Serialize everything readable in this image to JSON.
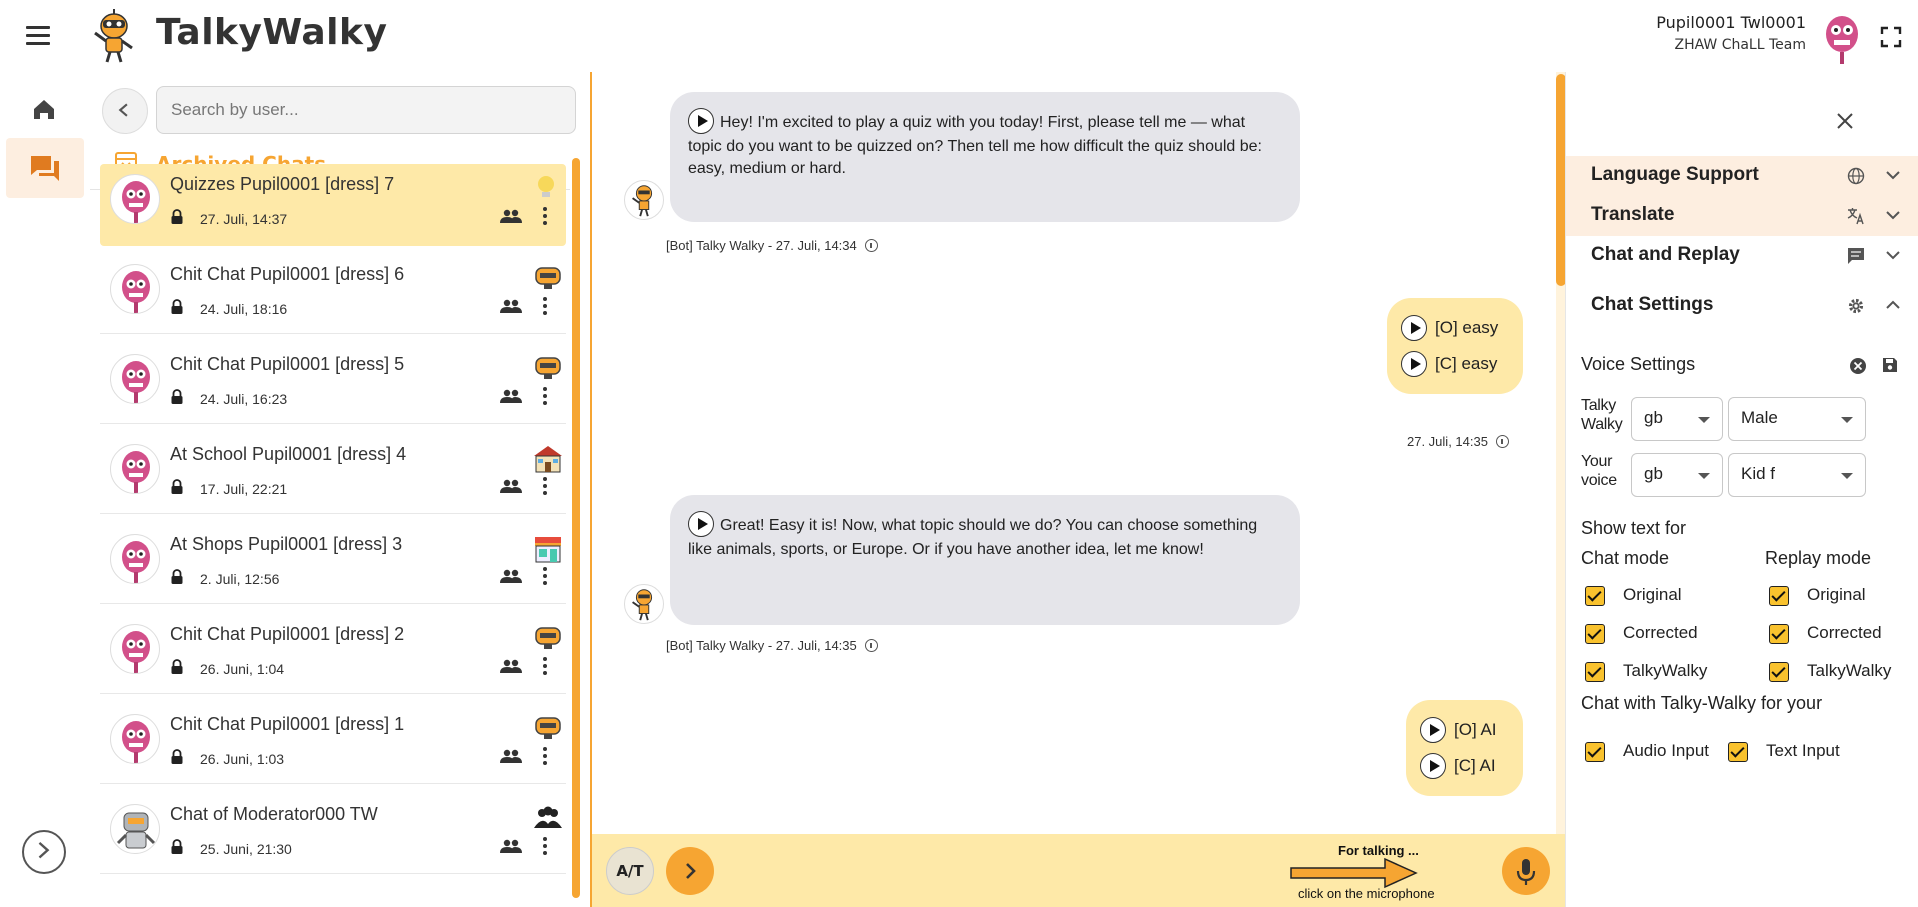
{
  "header": {
    "app_title": "TalkyWalky",
    "user_name": "Pupil0001 Twl0001",
    "user_team": "ZHAW ChaLL Team"
  },
  "sidebar": {
    "items": [
      {
        "name": "home",
        "icon": "home-icon"
      },
      {
        "name": "chats",
        "icon": "chat-icon",
        "active": true
      }
    ]
  },
  "chat_list": {
    "search_placeholder": "Search by user...",
    "archived_label": "Archived Chats",
    "items": [
      {
        "title": "Quizzes Pupil0001 [dress] 7",
        "date": "27. Juli, 14:37",
        "topic_icon": "lightbulb-icon",
        "selected": true
      },
      {
        "title": "Chit Chat Pupil0001 [dress] 6",
        "date": "24. Juli, 18:16",
        "topic_icon": "chit-chat-icon"
      },
      {
        "title": "Chit Chat Pupil0001 [dress] 5",
        "date": "24. Juli, 16:23",
        "topic_icon": "chit-chat-icon"
      },
      {
        "title": "At School Pupil0001 [dress] 4",
        "date": "17. Juli, 22:21",
        "topic_icon": "school-icon"
      },
      {
        "title": "At Shops Pupil0001 [dress] 3",
        "date": "2. Juli, 12:56",
        "topic_icon": "shop-icon"
      },
      {
        "title": "Chit Chat Pupil0001 [dress] 2",
        "date": "26. Juni, 1:04",
        "topic_icon": "chit-chat-icon"
      },
      {
        "title": "Chit Chat Pupil0001 [dress] 1",
        "date": "26. Juni, 1:03",
        "topic_icon": "chit-chat-icon"
      },
      {
        "title": "Chat of Moderator000 TW",
        "date": "25. Juni, 21:30",
        "topic_icon": "group-icon"
      }
    ]
  },
  "conversation": {
    "messages": [
      {
        "role": "bot",
        "text": "Hey! I'm excited to play a quiz with you today! First, please tell me — what topic do you want to be quizzed on? Then tell me how difficult the quiz should be: easy, medium or hard.",
        "meta": "[Bot] Talky Walky - 27. Juli, 14:34"
      },
      {
        "role": "user",
        "original": "[O] easy",
        "corrected": "[C] easy",
        "meta": "27. Juli, 14:35"
      },
      {
        "role": "bot",
        "text": "Great! Easy it is! Now, what topic should we do? You can choose something like animals, sports, or Europe. Or if you have another idea, let me know!",
        "meta": "[Bot] Talky Walky - 27. Juli, 14:35"
      },
      {
        "role": "user",
        "original": "[O] AI",
        "corrected": "[C] AI"
      }
    ],
    "input_bar": {
      "at_label": "A/T",
      "hint_top": "For talking ...",
      "hint_bottom": "click on the microphone"
    }
  },
  "panel": {
    "sections": [
      {
        "title": "Language Support",
        "icon": "globe-icon",
        "highlighted": true,
        "expanded": false
      },
      {
        "title": "Translate",
        "icon": "translate-icon",
        "highlighted": true,
        "expanded": false
      },
      {
        "title": "Chat and Replay",
        "icon": "message-icon",
        "highlighted": false,
        "expanded": false
      },
      {
        "title": "Chat Settings",
        "icon": "gear-icon",
        "highlighted": false,
        "expanded": true
      }
    ],
    "voice_settings": {
      "title": "Voice Settings",
      "talky_label": "Talky Walky",
      "talky_lang": "gb",
      "talky_voice": "Male",
      "your_label": "Your voice",
      "your_lang": "gb",
      "your_voice": "Kid f"
    },
    "show_text": {
      "title": "Show text for",
      "chat_mode_label": "Chat mode",
      "replay_mode_label": "Replay mode",
      "chat_mode": [
        {
          "label": "Original",
          "checked": true
        },
        {
          "label": "Corrected",
          "checked": true
        },
        {
          "label": "TalkyWalky",
          "checked": true
        }
      ],
      "replay_mode": [
        {
          "label": "Original",
          "checked": true
        },
        {
          "label": "Corrected",
          "checked": true
        },
        {
          "label": "TalkyWalky",
          "checked": true
        }
      ]
    },
    "chat_with": {
      "title": "Chat with Talky-Walky for your",
      "options": [
        {
          "label": "Audio Input",
          "checked": true
        },
        {
          "label": "Text Input",
          "checked": true
        }
      ]
    }
  },
  "colors": {
    "accent": "#f6a532",
    "highlight": "#fee9a8",
    "section_highlight": "#fdeee0",
    "checkbox": "#f9c22e"
  }
}
